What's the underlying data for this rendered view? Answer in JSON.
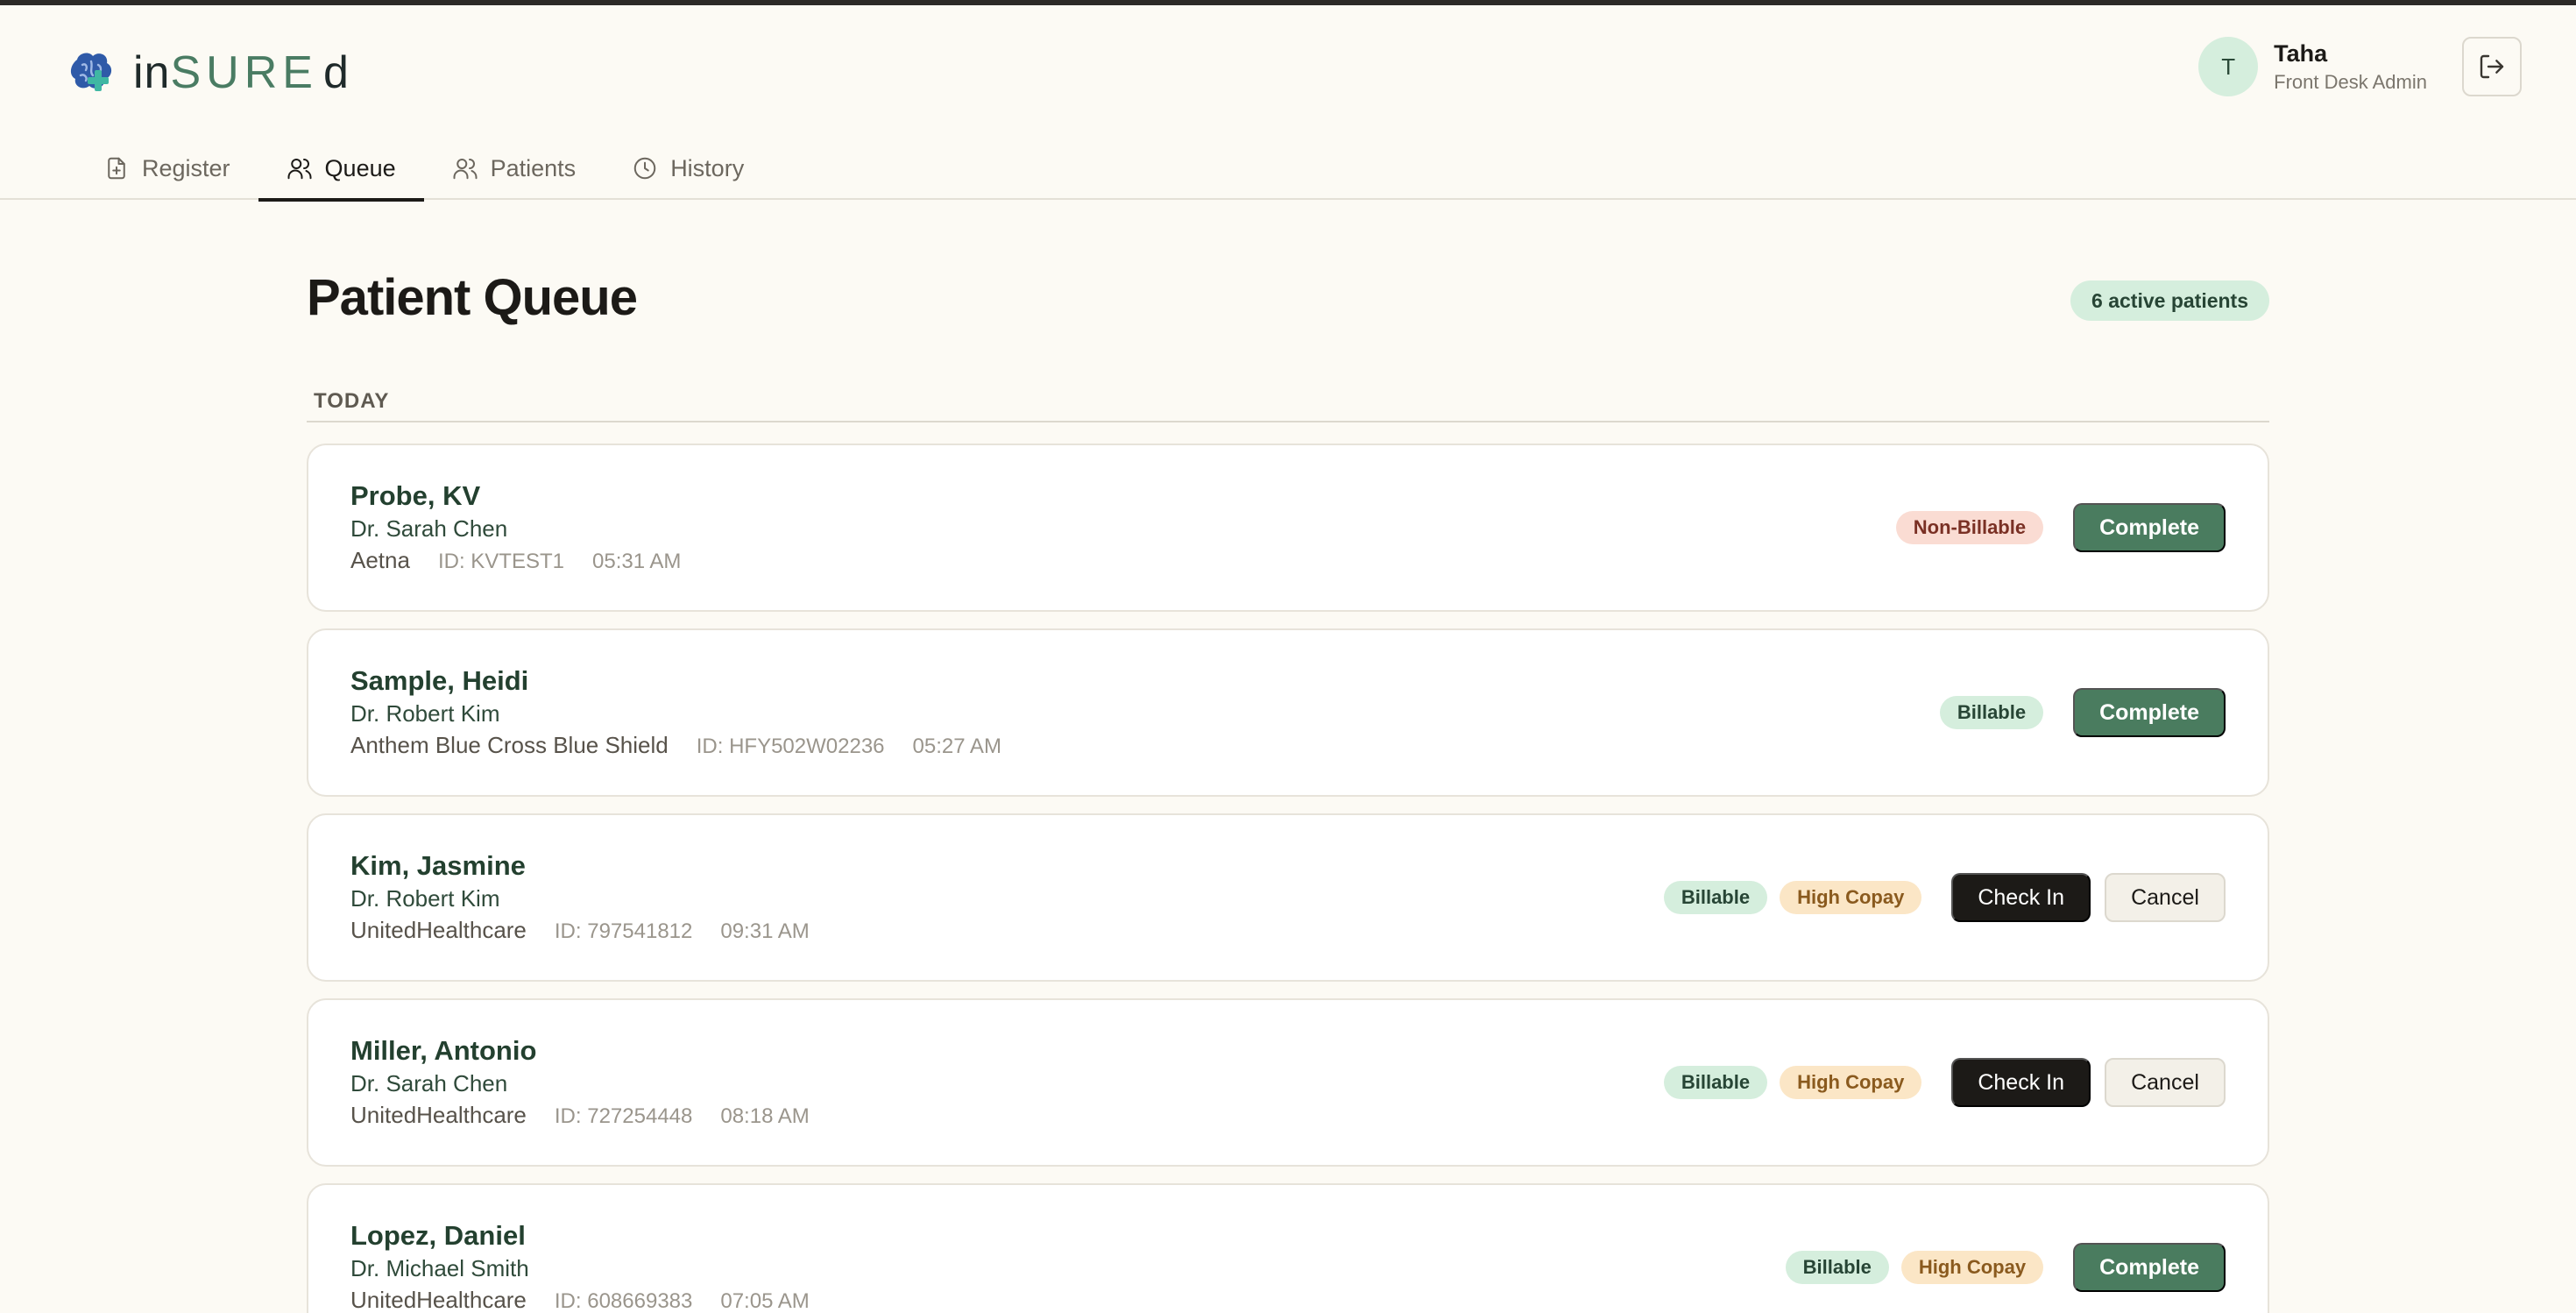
{
  "brand": {
    "prefix": "in",
    "middle": "SURE",
    "suffix": "d",
    "colors": {
      "primary": "#4a7c63",
      "logo_blue": "#2f5aa8",
      "logo_teal": "#3fb7a3"
    }
  },
  "user": {
    "initial": "T",
    "name": "Taha",
    "role": "Front Desk Admin",
    "logout_icon": "logout-icon"
  },
  "tabs": [
    {
      "label": "Register",
      "icon": "file-plus-icon",
      "active": false
    },
    {
      "label": "Queue",
      "icon": "users-icon",
      "active": true
    },
    {
      "label": "Patients",
      "icon": "users-icon",
      "active": false
    },
    {
      "label": "History",
      "icon": "clock-icon",
      "active": false
    }
  ],
  "page": {
    "title": "Patient Queue",
    "active_count": "6 active patients",
    "section": "TODAY"
  },
  "patients": [
    {
      "name": "Probe, KV",
      "doctor": "Dr. Sarah Chen",
      "insurer": "Aetna",
      "id": "ID: KVTEST1",
      "time": "05:31 AM",
      "badges": [
        "Non-Billable"
      ],
      "action": "Complete"
    },
    {
      "name": "Sample, Heidi",
      "doctor": "Dr. Robert Kim",
      "insurer": "Anthem Blue Cross Blue Shield",
      "id": "ID: HFY502W02236",
      "time": "05:27 AM",
      "badges": [
        "Billable"
      ],
      "action": "Complete"
    },
    {
      "name": "Kim, Jasmine",
      "doctor": "Dr. Robert Kim",
      "insurer": "UnitedHealthcare",
      "id": "ID: 797541812",
      "time": "09:31 AM",
      "badges": [
        "Billable",
        "High Copay"
      ],
      "action": "Check In",
      "secondary": "Cancel"
    },
    {
      "name": "Miller, Antonio",
      "doctor": "Dr. Sarah Chen",
      "insurer": "UnitedHealthcare",
      "id": "ID: 727254448",
      "time": "08:18 AM",
      "badges": [
        "Billable",
        "High Copay"
      ],
      "action": "Check In",
      "secondary": "Cancel"
    },
    {
      "name": "Lopez, Daniel",
      "doctor": "Dr. Michael Smith",
      "insurer": "UnitedHealthcare",
      "id": "ID: 608669383",
      "time": "07:05 AM",
      "badges": [
        "Billable",
        "High Copay"
      ],
      "action": "Complete"
    }
  ],
  "colors": {
    "background": "#fcfaf4",
    "billable": "#d5eedd",
    "high_copay": "#fbe6c6",
    "non_billable": "#fadcd3",
    "complete_button": "#4a7c5f",
    "checkin_button": "#1c1a17"
  }
}
